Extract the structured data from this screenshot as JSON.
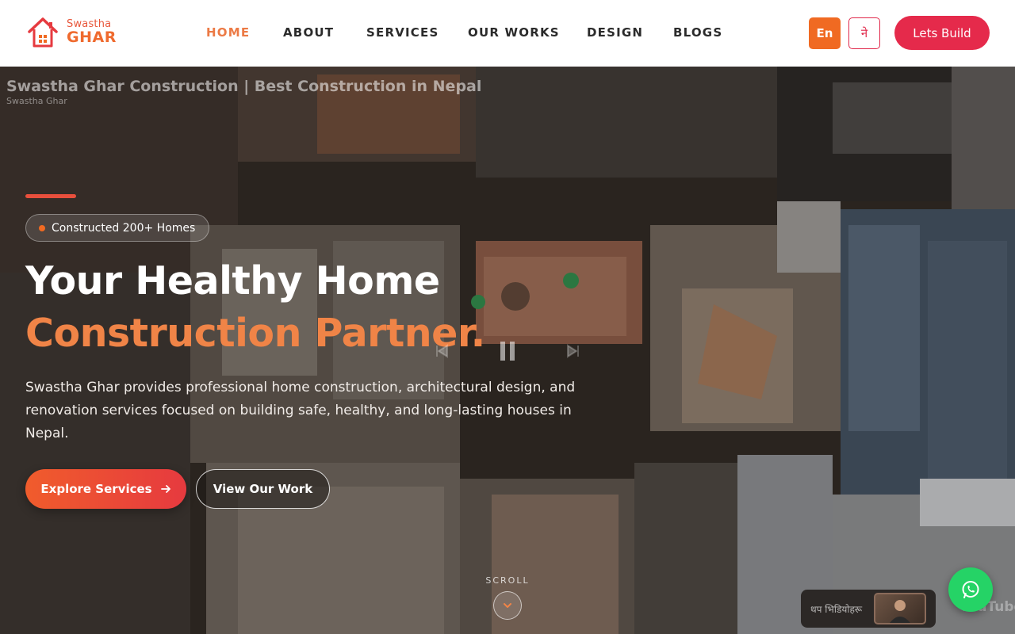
{
  "brand": {
    "logo_top": "Swastha",
    "logo_bottom": "GHAR",
    "primary_color": "#f06a22",
    "accent_color": "#e52a4b"
  },
  "nav": {
    "items": [
      {
        "label": "HOME",
        "active": true
      },
      {
        "label": "ABOUT",
        "active": false
      },
      {
        "label": "SERVICES",
        "active": false
      },
      {
        "label": "OUR WORKS",
        "active": false
      },
      {
        "label": "DESIGN",
        "active": false
      },
      {
        "label": "BLOGS",
        "active": false
      }
    ]
  },
  "header": {
    "lang_en": "En",
    "lang_ne": "ने",
    "cta_label": "Lets Build"
  },
  "video": {
    "title": "Swastha Ghar Construction | Best Construction in Nepal",
    "channel": "Swastha Ghar",
    "more_videos_label": "थप भिडियोहरू",
    "platform_logo": "YouTube"
  },
  "hero": {
    "badge": "Constructed 200+ Homes",
    "headline_line1": "Your Healthy Home",
    "headline_line2": "Construction Partner.",
    "description": "Swastha Ghar provides professional home construction, architectural design, and renovation services focused on building safe, healthy, and long-lasting houses in Nepal.",
    "primary_button": "Explore Services",
    "secondary_button": "View Our Work",
    "scroll_label": "SCROLL"
  },
  "icons": {
    "logo": "house-icon",
    "arrow": "arrow-right-icon",
    "scroll": "chevron-down-icon",
    "chat": "whatsapp-icon",
    "video": [
      "previous-icon",
      "pause-icon",
      "next-icon"
    ]
  }
}
